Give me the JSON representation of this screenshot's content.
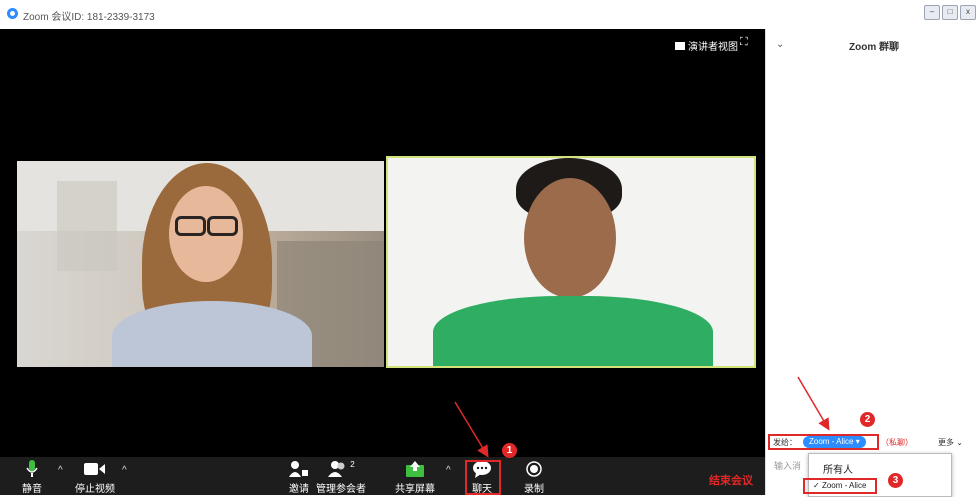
{
  "window": {
    "title": "Zoom 会议ID: 181-2339-3173"
  },
  "video_area": {
    "speaker_view_label": "演讲者视图"
  },
  "toolbar": {
    "mute_label": "静音",
    "stop_video_label": "停止视频",
    "invite_label": "邀请",
    "manage_participants_label": "管理参会者",
    "participant_count": "2",
    "share_screen_label": "共享屏幕",
    "chat_label": "聊天",
    "record_label": "录制",
    "end_meeting_label": "结束会议"
  },
  "chat_panel": {
    "title": "Zoom 群聊",
    "send_to_label": "发给：",
    "recipient": "Zoom - Alice",
    "private_label": "（私聊）",
    "more_label": "更多",
    "input_placeholder": "输入消",
    "dropdown_options": [
      "所有人",
      "Zoom - Alice"
    ],
    "dropdown_selected": "Zoom - Alice"
  },
  "annotations": {
    "step1": "1",
    "step2": "2",
    "step3": "3"
  },
  "colors": {
    "accent": "#2d8cff",
    "annotation_red": "#e02828",
    "end_meeting": "#e02828",
    "toolbar_bg": "#1d1d1d"
  }
}
